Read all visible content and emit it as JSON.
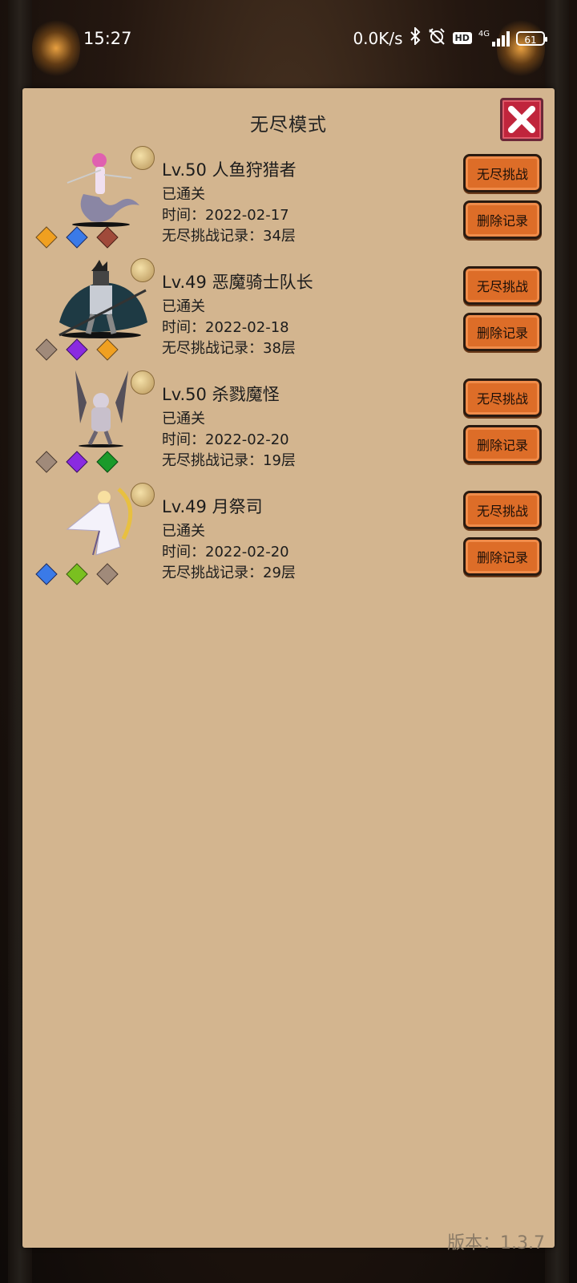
{
  "status_bar": {
    "time": "15:27",
    "network_speed": "0.0K/s",
    "hd_badge": "HD",
    "signal_label": "4G",
    "battery": "61"
  },
  "panel": {
    "title": "无尽模式",
    "close_icon": "close-x-icon"
  },
  "records": [
    {
      "name": "Lv.50 人鱼狩猎者",
      "status": "已通关",
      "time": "时间：2022-02-17",
      "record": "无尽挑战记录：34层",
      "challenge_label": "无尽挑战",
      "delete_label": "删除记录",
      "gems": [
        "#f0a020",
        "#3a7ae8",
        "#a04a3a"
      ]
    },
    {
      "name": "Lv.49 恶魔骑士队长",
      "status": "已通关",
      "time": "时间：2022-02-18",
      "record": "无尽挑战记录：38层",
      "challenge_label": "无尽挑战",
      "delete_label": "删除记录",
      "gems": [
        "#a08a7a",
        "#8a2ae0",
        "#f0a020"
      ]
    },
    {
      "name": "Lv.50 杀戮魔怪",
      "status": "已通关",
      "time": "时间：2022-02-20",
      "record": "无尽挑战记录：19层",
      "challenge_label": "无尽挑战",
      "delete_label": "删除记录",
      "gems": [
        "#a08a7a",
        "#8a2ae0",
        "#1a9a2a"
      ]
    },
    {
      "name": "Lv.49 月祭司",
      "status": "已通关",
      "time": "时间：2022-02-20",
      "record": "无尽挑战记录：29层",
      "challenge_label": "无尽挑战",
      "delete_label": "删除记录",
      "gems": [
        "#3a7ae8",
        "#7ac020",
        "#a08a7a"
      ]
    }
  ],
  "version_text": "版本：1.3.7"
}
